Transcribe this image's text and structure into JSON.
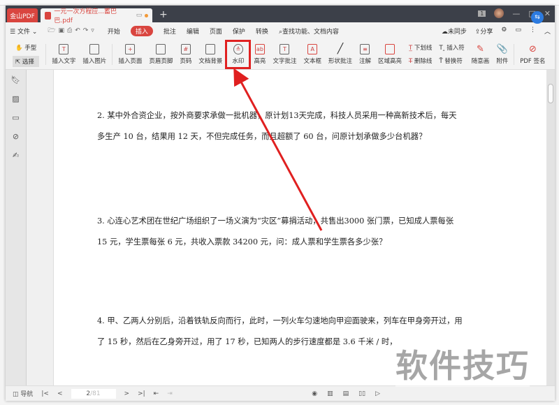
{
  "titlebar": {
    "home_tab": "金山PDF",
    "doc_tab": "一元一次方程应...蓄巴巴.pdf",
    "new_tab": "+",
    "badge": "1"
  },
  "menubar": {
    "file": "文件",
    "tabs": [
      "开始",
      "插入",
      "批注",
      "编辑",
      "页面",
      "保护",
      "转换"
    ],
    "active": "插入",
    "search": "查找功能、文档内容",
    "sync": "未同步",
    "share": "分享"
  },
  "toolbar": {
    "hand": "手型",
    "select": "选择",
    "items": [
      "插入文字",
      "插入图片",
      "插入页面",
      "页眉页脚",
      "页码",
      "文档背景",
      "水印",
      "高亮",
      "文字批注",
      "文本框",
      "形状批注",
      "注解",
      "区域高亮"
    ],
    "underline": "下划线",
    "strike": "删除线",
    "insert_mark": "插入符",
    "replace_mark": "替换符",
    "draw": "随意画",
    "attach": "附件",
    "sign": "PDF 签名"
  },
  "document": {
    "questions": [
      [
        "2. 某中外合资企业，按外商要求承做一批机器，原计划13天完成，科技人员采用一种高新技术后，每天",
        "多生产 10 台，结果用 12 天，不但完成任务，而且超额了 60 台，问原计划承做多少台机器？"
      ],
      [
        "3. 心连心艺术团在世纪广场组织了一场义演为“灾区”募捐活动，共售出3000 张门票，已知成人票每张",
        "15 元，学生票每张 6 元，共收入票款 34200 元，问：成人票和学生票各多少张？"
      ],
      [
        "4. 甲、乙两人分别后，沿着铁轨反向而行，此时，一列火车匀速地向甲迎面驶来，列车在甲身旁开过，用",
        "了 15 秒，然后在乙身旁开过，用了 17 秒，已知两人的步行速度都是 3.6 千米 / 时，"
      ]
    ]
  },
  "status": {
    "nav": "导航",
    "page": "2",
    "total": "/81"
  },
  "watermark": "软件技巧",
  "colors": {
    "accent": "#d9453f",
    "highlight": "#e02020"
  }
}
